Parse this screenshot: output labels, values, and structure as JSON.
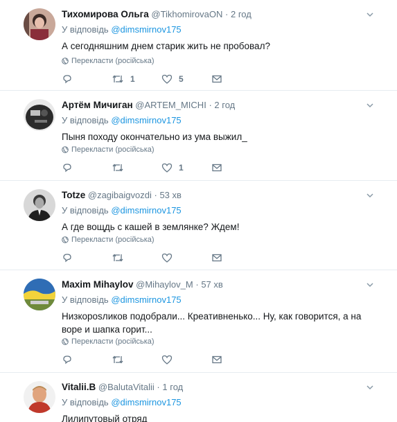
{
  "reply_prefix": "У відповідь",
  "translate_label": "Перекласти (російська)",
  "colors": {
    "link": "#1b95e0",
    "muted": "#657786",
    "text": "#14171a",
    "divider": "#e6ecf0"
  },
  "tweets": [
    {
      "name": "Тихомирова Ольга",
      "handle": "@TikhomirovaON",
      "time": "2 год",
      "reply_to": "@dimsmirnov175",
      "text": "А сегодняшним днем старик жить не пробовал?",
      "replies": "",
      "retweets": "1",
      "likes": "5"
    },
    {
      "name": "Артём Мичиган",
      "handle": "@ARTEM_MICHI",
      "time": "2 год",
      "reply_to": "@dimsmirnov175",
      "text": "Пыня походу окончательно из ума выжил_",
      "replies": "",
      "retweets": "",
      "likes": "1"
    },
    {
      "name": "Totze",
      "handle": "@zagibaigvozdi",
      "time": "53 хв",
      "reply_to": "@dimsmirnov175",
      "text": "А где вощдь с кашей в землянке? Ждем!",
      "replies": "",
      "retweets": "",
      "likes": ""
    },
    {
      "name": "Maxim Mihaylov",
      "handle": "@Mihaylov_M",
      "time": "57 хв",
      "reply_to": "@dimsmirnov175",
      "text": "Низкорosликов подобрали... Креативненько... Ну, как говорится, а на воре и шапка горит...",
      "replies": "",
      "retweets": "",
      "likes": ""
    },
    {
      "name": "Vitalii.B",
      "handle": "@BalutaVitalii",
      "time": "1 год",
      "reply_to": "@dimsmirnov175",
      "text": "Лилипутовый отряд",
      "replies": "",
      "retweets": "",
      "likes": ""
    }
  ]
}
